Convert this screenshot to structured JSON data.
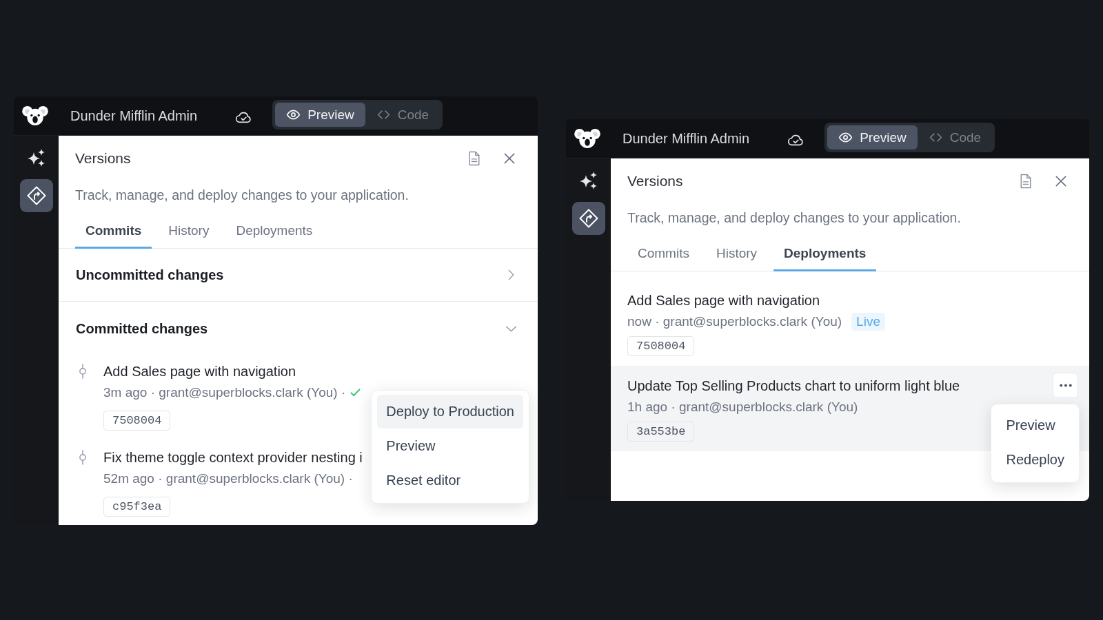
{
  "windows": [
    {
      "app_name": "Dunder Mifflin Admin",
      "modes": [
        {
          "kind": "preview",
          "label": "Preview",
          "selected": true
        },
        {
          "kind": "code",
          "label": "Code",
          "selected": false
        }
      ],
      "sidebar": [
        {
          "kind": "sparkle",
          "selected": false
        },
        {
          "kind": "branch",
          "selected": true
        }
      ],
      "panel": {
        "title": "Versions",
        "description": "Track, manage, and deploy changes to your application.",
        "tabs": [
          {
            "label": "Commits",
            "selected": true
          },
          {
            "label": "History",
            "selected": false
          },
          {
            "label": "Deployments",
            "selected": false
          }
        ],
        "sections": [
          {
            "title": "Uncommitted changes",
            "expanded": false
          },
          {
            "title": "Committed changes",
            "expanded": true,
            "commits": [
              {
                "title": "Add Sales page with navigation",
                "meta": "3m ago · grant@superblocks.clark (You) ·",
                "deployed": true,
                "hash": "7508004",
                "menu": [
                  {
                    "label": "Deploy to Production",
                    "selected": true
                  },
                  {
                    "label": "Preview",
                    "selected": false
                  },
                  {
                    "label": "Reset editor",
                    "selected": false
                  }
                ]
              },
              {
                "title": "Fix theme toggle context provider nesting i",
                "meta": "52m ago · grant@superblocks.clark (You) ·",
                "deployed": false,
                "hash": "c95f3ea"
              }
            ]
          }
        ]
      }
    },
    {
      "app_name": "Dunder Mifflin Admin",
      "modes": [
        {
          "kind": "preview",
          "label": "Preview",
          "selected": true
        },
        {
          "kind": "code",
          "label": "Code",
          "selected": false
        }
      ],
      "sidebar": [
        {
          "kind": "sparkle",
          "selected": false
        },
        {
          "kind": "branch",
          "selected": true
        }
      ],
      "panel": {
        "title": "Versions",
        "description": "Track, manage, and deploy changes to your application.",
        "tabs": [
          {
            "label": "Commits",
            "selected": false
          },
          {
            "label": "History",
            "selected": false
          },
          {
            "label": "Deployments",
            "selected": true
          }
        ],
        "deployments": [
          {
            "title": "Add Sales page with navigation",
            "meta": "now · grant@superblocks.clark (You)",
            "badge": "Live",
            "hash": "7508004",
            "highlighted": false,
            "more_button": false
          },
          {
            "title": "Update Top Selling Products chart to uniform light blue",
            "meta": "1h ago · grant@superblocks.clark (You)",
            "hash": "3a553be",
            "highlighted": true,
            "more_button": true,
            "menu": [
              {
                "label": "Preview",
                "selected": false
              },
              {
                "label": "Redeploy",
                "selected": false
              }
            ]
          }
        ]
      }
    }
  ]
}
